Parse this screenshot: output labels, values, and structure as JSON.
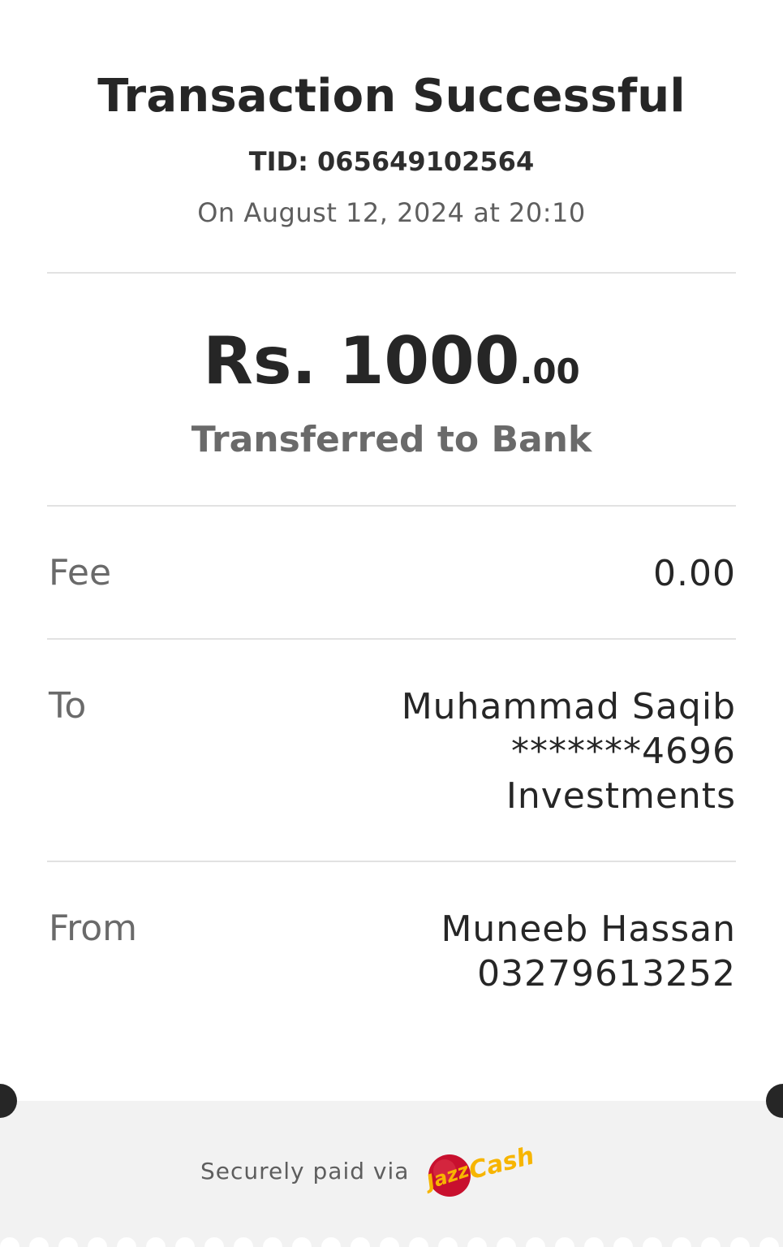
{
  "header": {
    "title": "Transaction Successful",
    "tid": "TID: 065649102564",
    "date": "On August 12, 2024 at 20:10"
  },
  "amount": {
    "main": "Rs. 1000",
    "cents": ".00",
    "subtitle": "Transferred to Bank"
  },
  "details": {
    "fee": {
      "label": "Fee",
      "value": "0.00"
    },
    "to": {
      "label": "To",
      "name": "Muhammad Saqib",
      "account": "*******4696",
      "bank": "Investments"
    },
    "from": {
      "label": "From",
      "name": "Muneeb Hassan",
      "phone": "03279613252"
    }
  },
  "footer": {
    "secure_text": "Securely paid via",
    "logo_text": "JazzCash",
    "logo_name": "jazzcash-logo",
    "colors": {
      "logo_red": "#c8102e",
      "logo_yellow": "#f7b500",
      "footer_bg": "#f2f2f2"
    }
  }
}
